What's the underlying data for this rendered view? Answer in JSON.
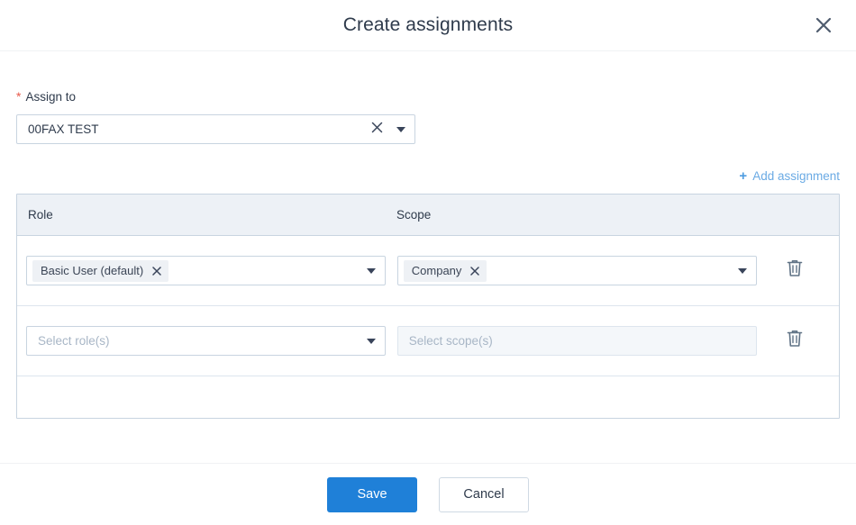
{
  "dialog": {
    "title": "Create assignments",
    "close_icon": "close-x-icon"
  },
  "assign_to": {
    "label": "Assign to",
    "required_marker": "*",
    "value": "00FAX TEST",
    "clear_icon": "clear-x-icon",
    "caret_icon": "chevron-down-icon"
  },
  "add_assignment": {
    "plus": "+",
    "label": "Add assignment"
  },
  "table": {
    "headers": {
      "role": "Role",
      "scope": "Scope"
    },
    "rows": [
      {
        "role_tag": "Basic User (default)",
        "role_tag_x": "×",
        "scope_tag": "Company",
        "scope_tag_x": "×",
        "role_placeholder": "",
        "scope_placeholder": "",
        "delete_icon": "trash-icon"
      },
      {
        "role_tag": "",
        "scope_tag": "",
        "role_placeholder": "Select role(s)",
        "scope_placeholder": "Select scope(s)",
        "delete_icon": "trash-icon"
      }
    ]
  },
  "footer": {
    "save_label": "Save",
    "cancel_label": "Cancel"
  },
  "colors": {
    "accent_blue": "#1f80d8",
    "link_blue": "#6aaae4",
    "required_red": "#e8594a",
    "header_bg": "#edf1f6",
    "border": "#c8d4e0",
    "text": "#2f3b4c",
    "placeholder": "#a8b6c6",
    "tag_bg": "#eef1f5"
  }
}
